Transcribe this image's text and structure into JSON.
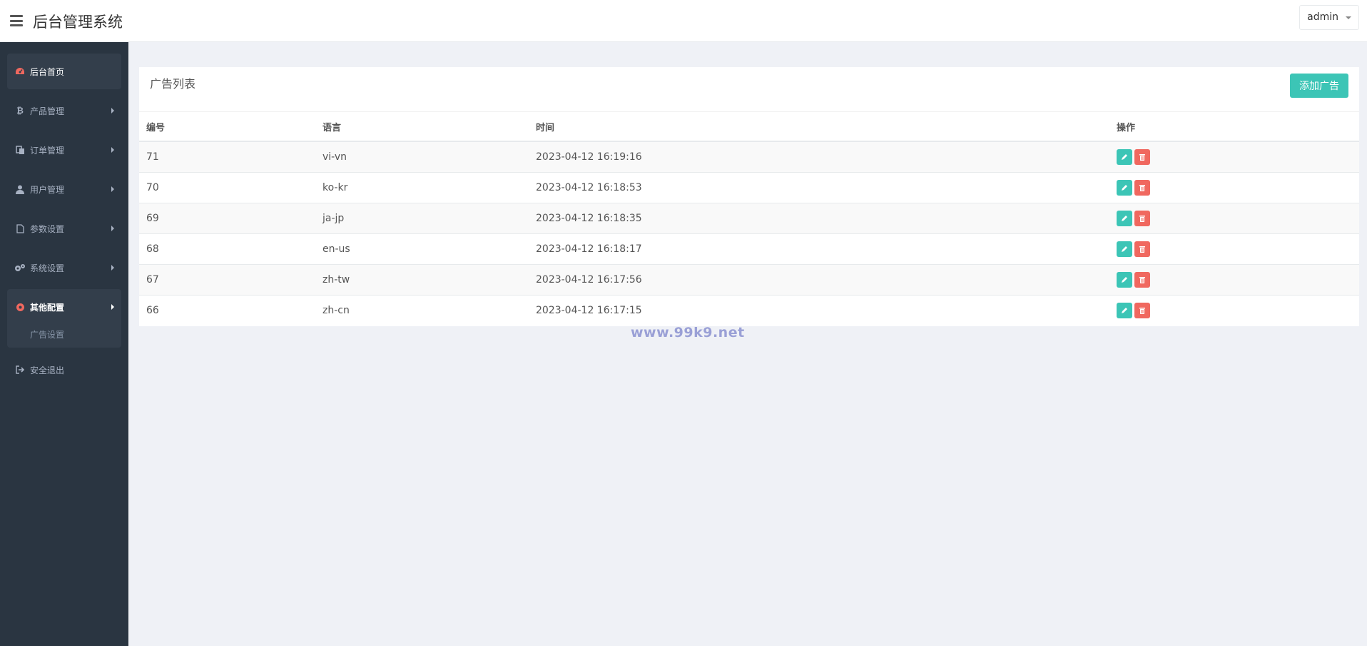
{
  "header": {
    "app_title": "后台管理系统",
    "user_label": "admin",
    "menu_icon": "hamburger-icon"
  },
  "sidebar": {
    "items": [
      {
        "label": "后台首页",
        "icon": "dashboard-icon"
      },
      {
        "label": "产品管理",
        "icon": "bitcoin-icon"
      },
      {
        "label": "订单管理",
        "icon": "copy-icon"
      },
      {
        "label": "用户管理",
        "icon": "user-icon"
      },
      {
        "label": "参数设置",
        "icon": "file-icon"
      },
      {
        "label": "系统设置",
        "icon": "gears-icon"
      },
      {
        "label": "其他配置",
        "icon": "gear-icon"
      },
      {
        "label": "安全退出",
        "icon": "sign-out-icon"
      }
    ],
    "submenu": [
      {
        "label": "广告设置"
      }
    ]
  },
  "main": {
    "panel_title": "广告列表",
    "add_button": "添加广告",
    "columns": [
      "编号",
      "语言",
      "时间",
      "操作"
    ],
    "rows": [
      {
        "id": "71",
        "lang": "vi-vn",
        "time": "2023-04-12 16:19:16"
      },
      {
        "id": "70",
        "lang": "ko-kr",
        "time": "2023-04-12 16:18:53"
      },
      {
        "id": "69",
        "lang": "ja-jp",
        "time": "2023-04-12 16:18:35"
      },
      {
        "id": "68",
        "lang": "en-us",
        "time": "2023-04-12 16:18:17"
      },
      {
        "id": "67",
        "lang": "zh-tw",
        "time": "2023-04-12 16:17:56"
      },
      {
        "id": "66",
        "lang": "zh-cn",
        "time": "2023-04-12 16:17:15"
      }
    ]
  },
  "watermark": "www.99k9.net",
  "colors": {
    "accent": "#3cc5b6",
    "danger": "#f0685f",
    "sidebar": "#2a3541",
    "active_icon": "#f0685f"
  }
}
